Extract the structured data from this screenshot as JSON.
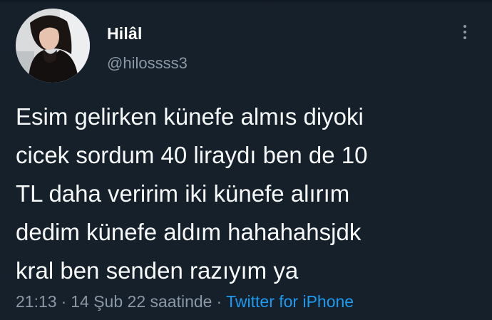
{
  "author": {
    "display_name": "Hilâl",
    "handle": "@hilossss3"
  },
  "tweet": {
    "lines": [
      "Esim gelirken künefe almıs diyoki",
      "cicek sordum 40 liraydı ben de 10",
      "TL daha veririm iki künefe alırım",
      "dedim künefe aldım hahahahsjdk",
      "kral ben senden razıyım ya"
    ]
  },
  "meta": {
    "time": "21:13",
    "separator": "·",
    "date": "14 Şub 22 saatinde",
    "source": "Twitter for iPhone"
  },
  "icons": {
    "more": "more-vertical-icon"
  },
  "colors": {
    "background": "#15202b",
    "text": "#f7f9f9",
    "secondary": "#8b98a5",
    "accent": "#1d9bf0"
  }
}
